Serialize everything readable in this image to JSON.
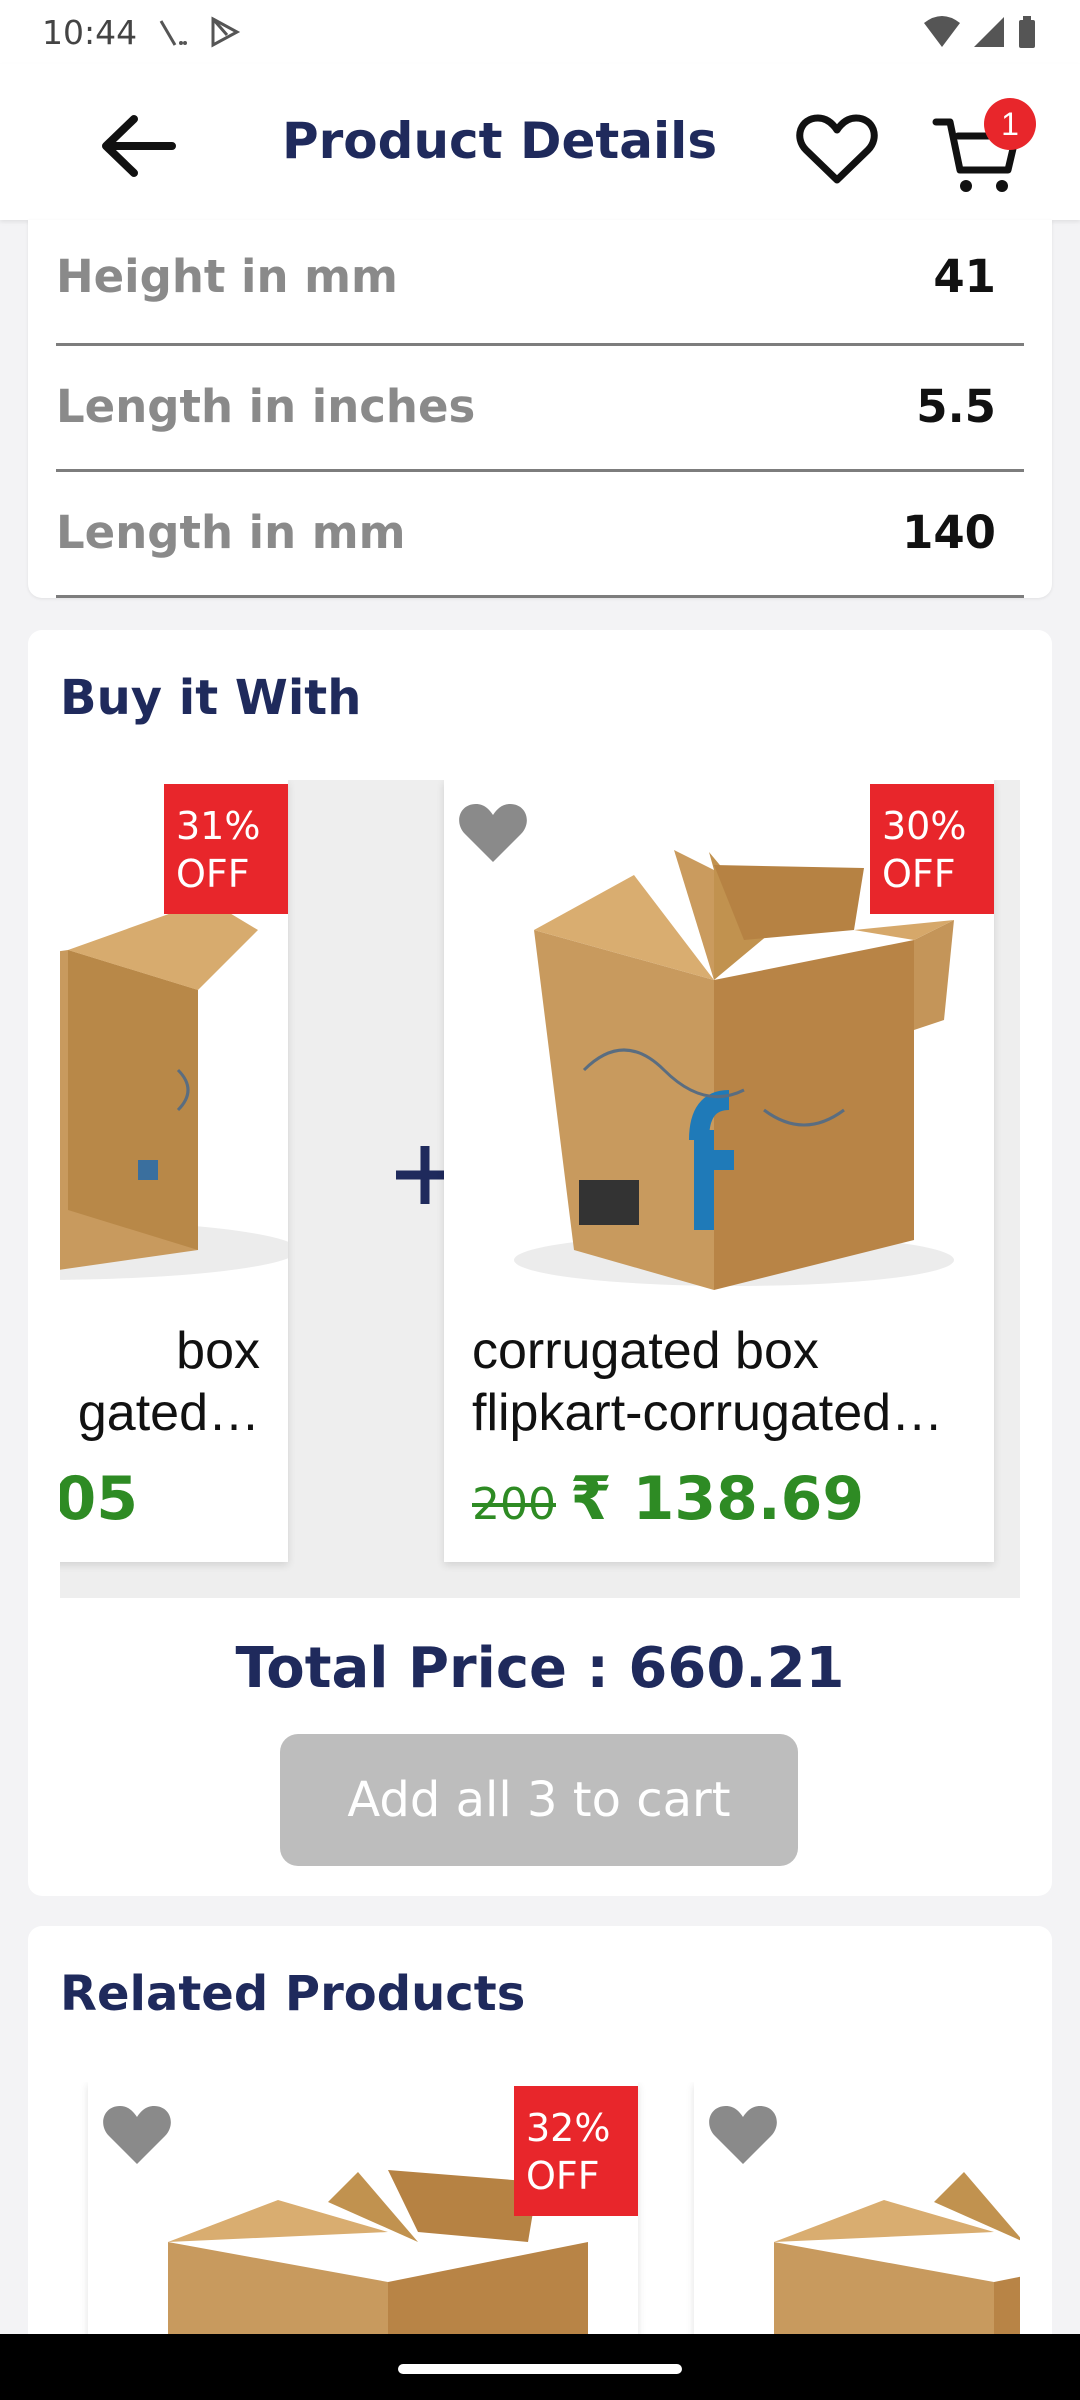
{
  "status_bar": {
    "time": "10:44"
  },
  "app_bar": {
    "title": "Product Details",
    "cart_count": "1"
  },
  "specs": [
    {
      "label": "Height in mm",
      "value": "41"
    },
    {
      "label": "Length in inches",
      "value": "5.5"
    },
    {
      "label": "Length in mm",
      "value": "140"
    }
  ],
  "bundle": {
    "title": "Buy it With",
    "items": [
      {
        "discount_line1": "31%",
        "discount_line2": "OFF",
        "name_line1": "box",
        "name_line2": "gated…",
        "price": "05"
      },
      {
        "discount_line1": "30%",
        "discount_line2": "OFF",
        "name_line1": "corrugated box",
        "name_line2": "flipkart-corrugated…",
        "mrp": "200",
        "price": "₹ 138.69"
      }
    ],
    "total": "Total Price : 660.21",
    "add_all_label": "Add all 3 to cart"
  },
  "related": {
    "title": "Related Products",
    "items": [
      {
        "discount_line1": "32%",
        "discount_line2": "OFF"
      }
    ]
  },
  "colors": {
    "brand_navy": "#1f2a5c",
    "discount_red": "#e8262b",
    "price_green": "#2e8b24",
    "disabled_button": "#bdbdbd"
  }
}
